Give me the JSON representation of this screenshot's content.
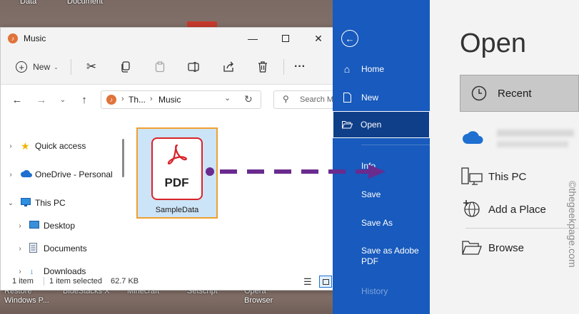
{
  "desktop": {
    "top_labels": [
      "Data",
      "Document"
    ],
    "bottom_labels": [
      "Restore\nWindows P...",
      "BlueStacks X",
      "Minecraft",
      "Setscript",
      "Opera\nBrowser"
    ]
  },
  "explorer": {
    "title": "Music",
    "toolbar": {
      "new_label": "New",
      "more": "···"
    },
    "address": {
      "segment1": "Th...",
      "segment2": "Music"
    },
    "search": {
      "placeholder": "Search M"
    },
    "nav": [
      {
        "label": "Quick access"
      },
      {
        "label": "OneDrive - Personal"
      },
      {
        "label": "This PC"
      },
      {
        "label": "Desktop"
      },
      {
        "label": "Documents"
      },
      {
        "label": "Downloads"
      }
    ],
    "file": {
      "badge": "PDF",
      "name": "SampleData"
    },
    "status": {
      "count": "1 item",
      "selected": "1 item selected",
      "size": "62.7 KB"
    }
  },
  "word": {
    "nav": [
      {
        "label": "Home"
      },
      {
        "label": "New"
      },
      {
        "label": "Open"
      },
      {
        "label": "Info"
      },
      {
        "label": "Save"
      },
      {
        "label": "Save As"
      },
      {
        "label": "Save as Adobe PDF"
      },
      {
        "label": "History"
      }
    ],
    "open": {
      "heading": "Open",
      "items": [
        {
          "label": "Recent"
        },
        {
          "label": "This PC"
        },
        {
          "label": "Add a Place"
        },
        {
          "label": "Browse"
        }
      ]
    },
    "watermark": "©thegeekpage.com"
  },
  "colors": {
    "accent": "#185abd",
    "arrow": "#6a2b8f",
    "highlight": "#f0a030",
    "pdf": "#d8232a"
  }
}
